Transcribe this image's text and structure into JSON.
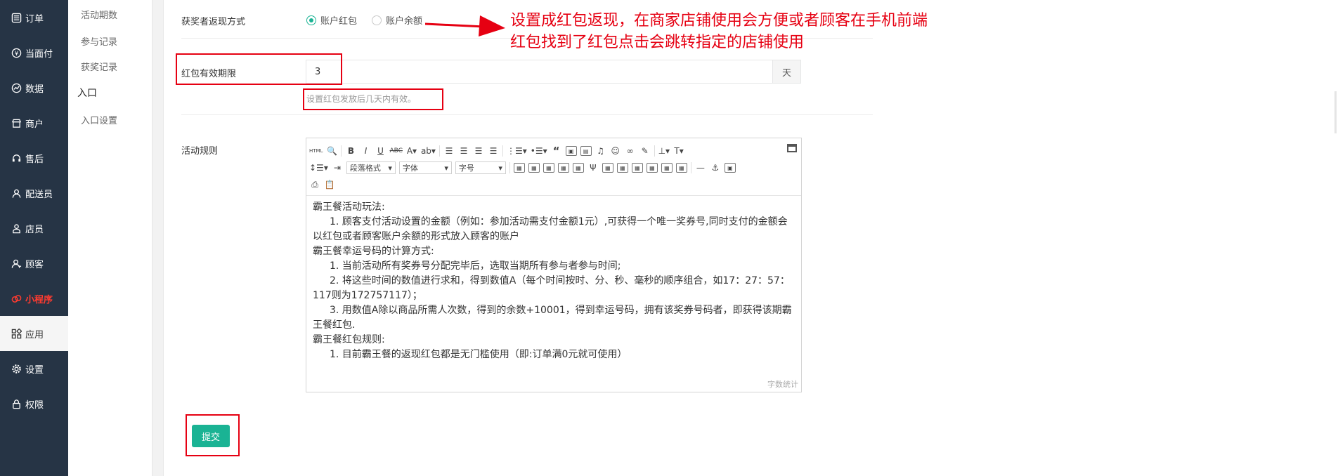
{
  "sidebar": {
    "items": [
      {
        "label": "订单",
        "icon": "list-icon"
      },
      {
        "label": "当面付",
        "icon": "coin-icon"
      },
      {
        "label": "数据",
        "icon": "chart-icon"
      },
      {
        "label": "商户",
        "icon": "store-icon"
      },
      {
        "label": "售后",
        "icon": "headset-icon"
      },
      {
        "label": "配送员",
        "icon": "user-icon"
      },
      {
        "label": "店员",
        "icon": "staff-icon"
      },
      {
        "label": "顾客",
        "icon": "customer-icon"
      },
      {
        "label": "小程序",
        "icon": "miniprogram-icon"
      },
      {
        "label": "应用",
        "icon": "apps-icon"
      },
      {
        "label": "设置",
        "icon": "gear-icon"
      },
      {
        "label": "权限",
        "icon": "lock-icon"
      }
    ],
    "highlight_color": "#ff3b30"
  },
  "subnav": {
    "items": [
      "活动期数",
      "参与记录",
      "获奖记录"
    ],
    "group": "入口",
    "group_items": [
      "入口设置"
    ]
  },
  "form": {
    "refund_label": "获奖者返现方式",
    "radio_account_redpack": "账户红包",
    "radio_account_balance": "账户余额",
    "validity_label": "红包有效期限",
    "validity_value": "3",
    "validity_unit": "天",
    "validity_help": "设置红包发放后几天内有效。",
    "rules_label": "活动规则",
    "submit_label": "提交"
  },
  "editor": {
    "toolbar": {
      "paragraph_format": "段落格式",
      "font_family": "字体",
      "font_size": "字号"
    },
    "content": [
      "霸王餐活动玩法:",
      "1. 顾客支付活动设置的金额（例如：参加活动需支付金额1元）,可获得一个唯一奖券号,同时支付的金额会以红包或者顾客账户余额的形式放入顾客的账户",
      "霸王餐幸运号码的计算方式:",
      "1. 当前活动所有奖券号分配完毕后，选取当期所有参与者参与时间;",
      "2. 将这些时间的数值进行求和，得到数值A（每个时间按时、分、秒、毫秒的顺序组合，如17：27：57：117则为172757117）；",
      "3. 用数值A除以商品所需人次数，得到的余数+10001，得到幸运号码，拥有该奖券号码者，即获得该期霸王餐红包.",
      "霸王餐红包规则:",
      "1. 目前霸王餐的返现红包都是无门槛使用（即:订单满0元就可使用）"
    ],
    "word_count": "字数统计"
  },
  "annotation": {
    "line1": "设置成红包返现，在商家店铺使用会方便或者顾客在手机前端",
    "line2": "红包找到了红包点击会跳转指定的店铺使用",
    "color": "#e60012"
  },
  "colors": {
    "sidebar_bg": "#263445",
    "accent": "#1ab394"
  }
}
